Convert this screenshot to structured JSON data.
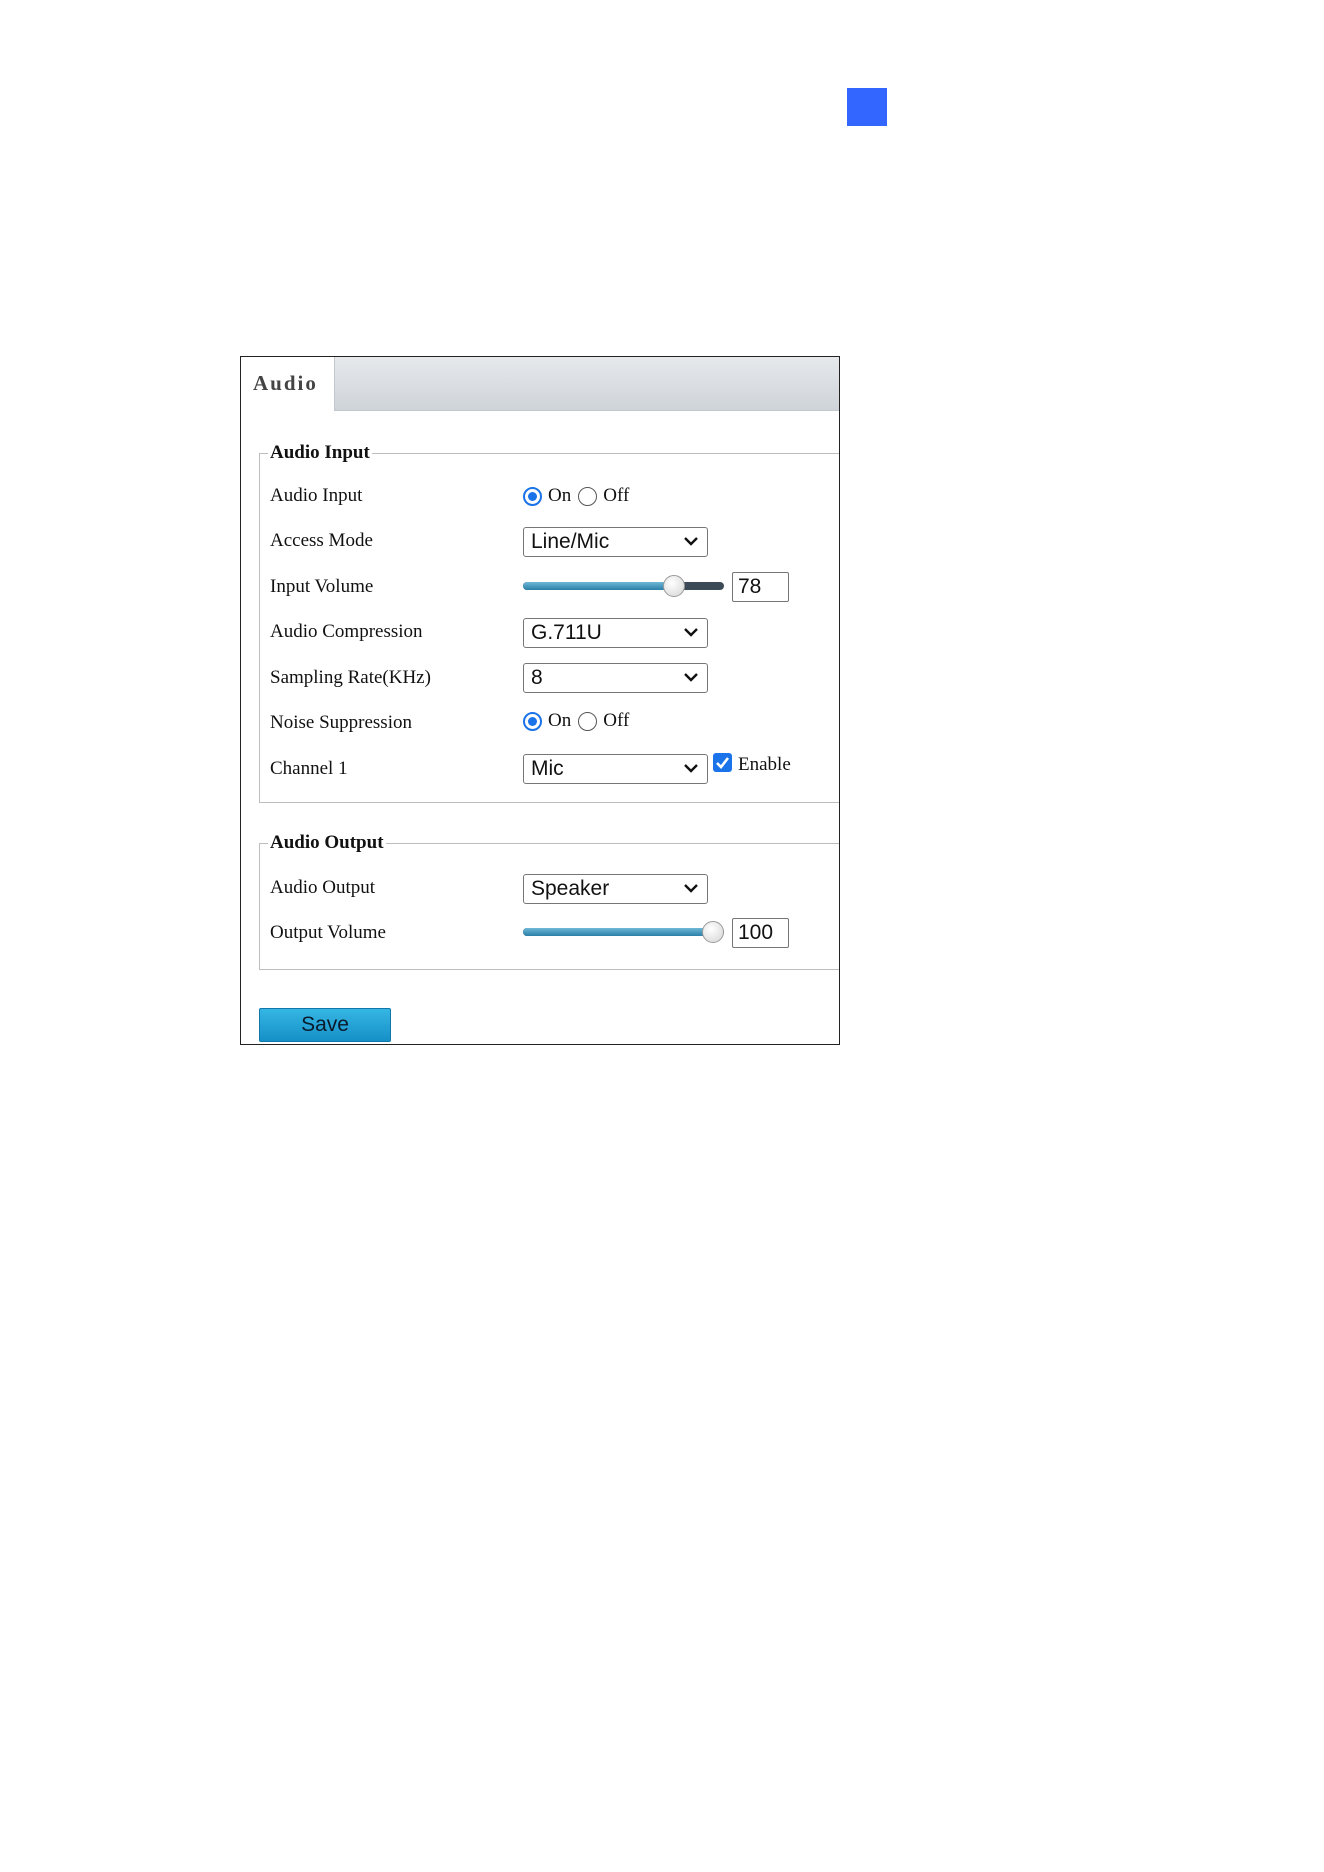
{
  "colors": {
    "accent": "#1a73e8",
    "save_button": "#1fa0d6",
    "corner_marker": "#3366ff"
  },
  "tab": {
    "label": "Audio"
  },
  "audio_input": {
    "title": "Audio Input",
    "audio_input": {
      "label": "Audio Input",
      "on": "On",
      "off": "Off",
      "selected": "On"
    },
    "access_mode": {
      "label": "Access Mode",
      "value": "Line/Mic"
    },
    "input_volume": {
      "label": "Input Volume",
      "value": "78",
      "level": 78,
      "max": 100
    },
    "audio_compression": {
      "label": "Audio Compression",
      "value": "G.711U"
    },
    "sampling_rate": {
      "label": "Sampling Rate(KHz)",
      "value": "8"
    },
    "noise_suppression": {
      "label": "Noise Suppression",
      "on": "On",
      "off": "Off",
      "selected": "On"
    },
    "channel1": {
      "label": "Channel 1",
      "value": "Mic",
      "enable_label": "Enable",
      "enabled": true
    }
  },
  "audio_output": {
    "title": "Audio Output",
    "audio_output": {
      "label": "Audio Output",
      "value": "Speaker"
    },
    "output_volume": {
      "label": "Output Volume",
      "value": "100",
      "level": 100,
      "max": 100
    }
  },
  "save_label": "Save"
}
